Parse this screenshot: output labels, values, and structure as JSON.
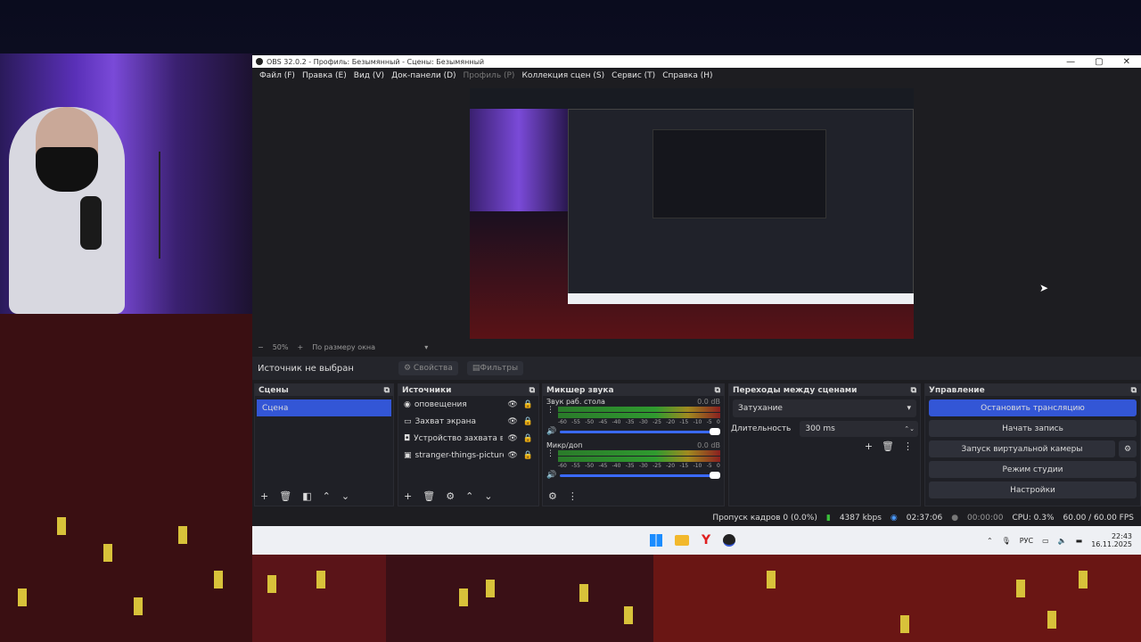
{
  "window": {
    "title": "OBS 32.0.2 - Профиль: Безымянный - Сцены: Безымянный",
    "controls": [
      "—",
      "▢",
      "✕"
    ]
  },
  "menu": [
    {
      "label": "Файл (F)",
      "enabled": true
    },
    {
      "label": "Правка (E)",
      "enabled": true
    },
    {
      "label": "Вид (V)",
      "enabled": true
    },
    {
      "label": "Док-панели (D)",
      "enabled": true
    },
    {
      "label": "Профиль (P)",
      "enabled": false
    },
    {
      "label": "Коллекция сцен (S)",
      "enabled": true
    },
    {
      "label": "Сервис (T)",
      "enabled": true
    },
    {
      "label": "Справка (H)",
      "enabled": true
    }
  ],
  "zoom": {
    "minus": "−",
    "value": "50%",
    "plus": "+",
    "fit": "По размеру окна"
  },
  "source_bar": {
    "no_source": "Источник не выбран",
    "properties": "Свойства",
    "filters": "Фильтры"
  },
  "scenes": {
    "title": "Сцены",
    "items": [
      "Сцена"
    ]
  },
  "sources": {
    "title": "Источники",
    "items": [
      {
        "name": "оповещения",
        "icon": "globe-icon"
      },
      {
        "name": "Захват экрана",
        "icon": "monitor-icon"
      },
      {
        "name": "Устройство захвата виде",
        "icon": "camera-icon"
      },
      {
        "name": "stranger-things-pictures-€",
        "icon": "image-icon"
      }
    ]
  },
  "mixer": {
    "title": "Микшер звука",
    "channels": [
      {
        "name": "Звук раб. стола",
        "db": "0.0 dB"
      },
      {
        "name": "Микр/доп",
        "db": "0.0 dB"
      }
    ],
    "scale": [
      "-60",
      "-55",
      "-50",
      "-45",
      "-40",
      "-35",
      "-30",
      "-25",
      "-20",
      "-15",
      "-10",
      "-5",
      "0"
    ]
  },
  "transitions": {
    "title": "Переходы между сценами",
    "selected": "Затухание",
    "duration_label": "Длительность",
    "duration_value": "300 ms"
  },
  "controls": {
    "title": "Управление",
    "stop_stream": "Остановить трансляцию",
    "start_record": "Начать запись",
    "virtual_cam": "Запуск виртуальной камеры",
    "studio_mode": "Режим студии",
    "settings": "Настройки"
  },
  "status": {
    "dropped": "Пропуск кадров 0 (0.0%)",
    "bitrate": "4387 kbps",
    "stream_time": "02:37:06",
    "record_time": "00:00:00",
    "cpu": "CPU: 0.3%",
    "fps": "60.00 / 60.00 FPS"
  },
  "taskbar": {
    "lang": "РУС",
    "time": "22:43",
    "date": "16.11.2025"
  },
  "colors": {
    "accent": "#3356d6",
    "panel": "#1f2026",
    "bg": "#1d1d21"
  }
}
